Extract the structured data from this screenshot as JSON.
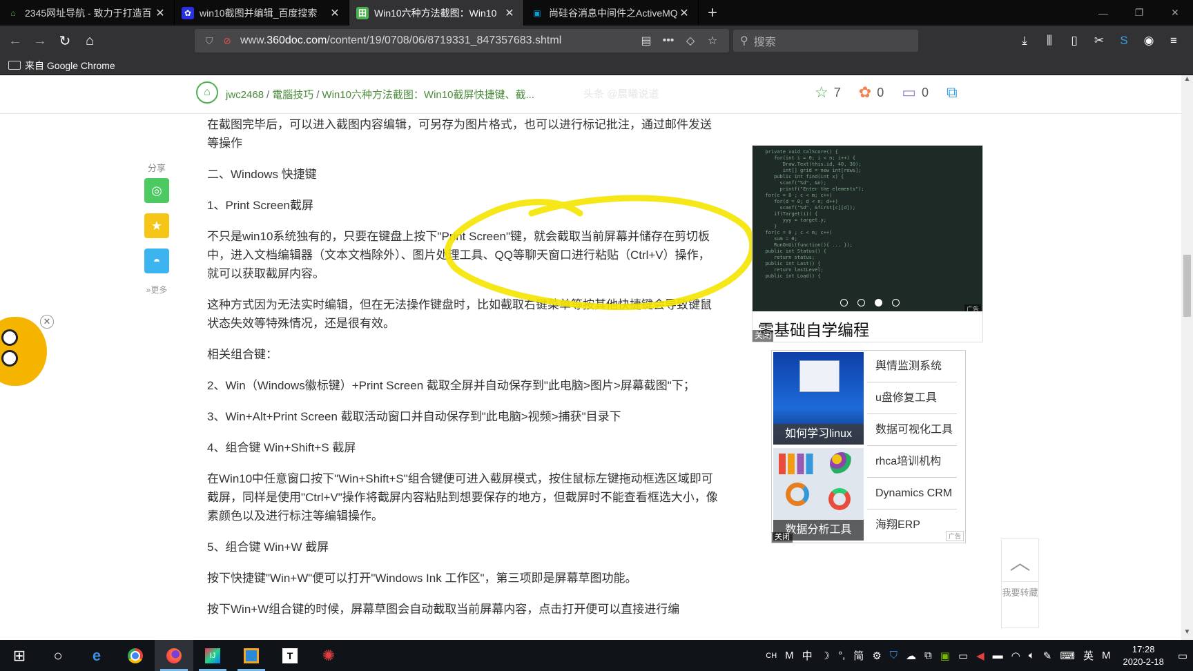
{
  "tabs": [
    {
      "title": "2345网址导航 - 致力于打造百",
      "favicon": "2345-favicon",
      "active": false
    },
    {
      "title": "win10截图并编辑_百度搜索",
      "favicon": "baidu-favicon",
      "active": false
    },
    {
      "title": "Win10六种方法截图：Win10",
      "favicon": "360doc-favicon",
      "active": true
    },
    {
      "title": "尚硅谷消息中间件之ActiveMQ",
      "favicon": "bilibili-favicon",
      "active": false
    }
  ],
  "window_controls": {
    "minimize": "—",
    "restore": "❐",
    "close": "✕"
  },
  "urlbar": {
    "url_prefix": "www.",
    "url_domain": "360doc.com",
    "url_path": "/content/19/0708/06/8719331_847357683.shtml"
  },
  "search": {
    "placeholder": "搜索"
  },
  "bookmarks": {
    "item": "来自 Google Chrome"
  },
  "breadcrumb": {
    "user": "jwc2468",
    "category": "電腦技巧",
    "title": "Win10六种方法截图：Win10截屏快捷键、截..."
  },
  "watermark": "头条 @晨曦说道",
  "stats": {
    "favorites": "7",
    "flowers": "0",
    "comments": "0"
  },
  "share": {
    "label": "分享",
    "more": "更多"
  },
  "article": {
    "p1": "在截图完毕后，可以进入截图内容编辑，可另存为图片格式，也可以进行标记批注，通过邮件发送等操作",
    "h2": "二、Windows 快捷键",
    "h2_1": "1、Print Screen截屏",
    "p2": "不只是win10系统独有的，只要在键盘上按下\"Print Screen\"键，就会截取当前屏幕并储存在剪切板中，进入文档编辑器（文本文档除外）、图片处理工具、QQ等聊天窗口进行粘贴（Ctrl+V）操作，就可以获取截屏内容。",
    "p3": "这种方式因为无法实时编辑，但在无法操作键盘时，比如截取右键菜单等按其他快捷键会导致键鼠状态失效等特殊情况，还是很有效。",
    "p4": "相关组合键：",
    "p5": "2、Win（Windows徽标键）+Print Screen 截取全屏并自动保存到\"此电脑>图片>屏幕截图\"下；",
    "p6": "3、Win+Alt+Print Screen 截取活动窗口并自动保存到\"此电脑>视频>捕获\"目录下",
    "p7": "4、组合键 Win+Shift+S 截屏",
    "p8": "在Win10中任意窗口按下\"Win+Shift+S\"组合键便可进入截屏模式，按住鼠标左键拖动框选区域即可截屏，同样是使用\"Ctrl+V\"操作将截屏内容粘贴到想要保存的地方，但截屏时不能查看框选大小，像素颜色以及进行标注等编辑操作。",
    "p9": "5、组合键 Win+W 截屏",
    "p10": "按下快捷键\"Win+W\"便可以打开\"Windows Ink 工作区\"，第三项即是屏幕草图功能。",
    "p11": "按下Win+W组合键的时候，屏幕草图会自动截取当前屏幕内容，点击打开便可以直接进行编"
  },
  "ad1": {
    "caption": "零基础自学编程",
    "close": "关闭",
    "adtag": "广告"
  },
  "ad2": {
    "thumb1": "如何学习linux",
    "thumb2": "数据分析工具",
    "links": [
      "舆情监测系统",
      "u盘修复工具",
      "数据可视化工具",
      "rhca培训机构",
      "Dynamics CRM",
      "海翔ERP"
    ],
    "close": "关闭",
    "adtag": "广告"
  },
  "backtop": {
    "label": "我要转藏"
  },
  "taskbar": {
    "tray_lang": "CH",
    "tray_ime": "中",
    "tray_simplified": "简",
    "tray_ying": "英",
    "time": "17:28",
    "date": "2020-2-18"
  },
  "colors": {
    "accent_green": "#4caf50",
    "annotation_yellow": "#f5e400",
    "tab_active": "#323234"
  }
}
